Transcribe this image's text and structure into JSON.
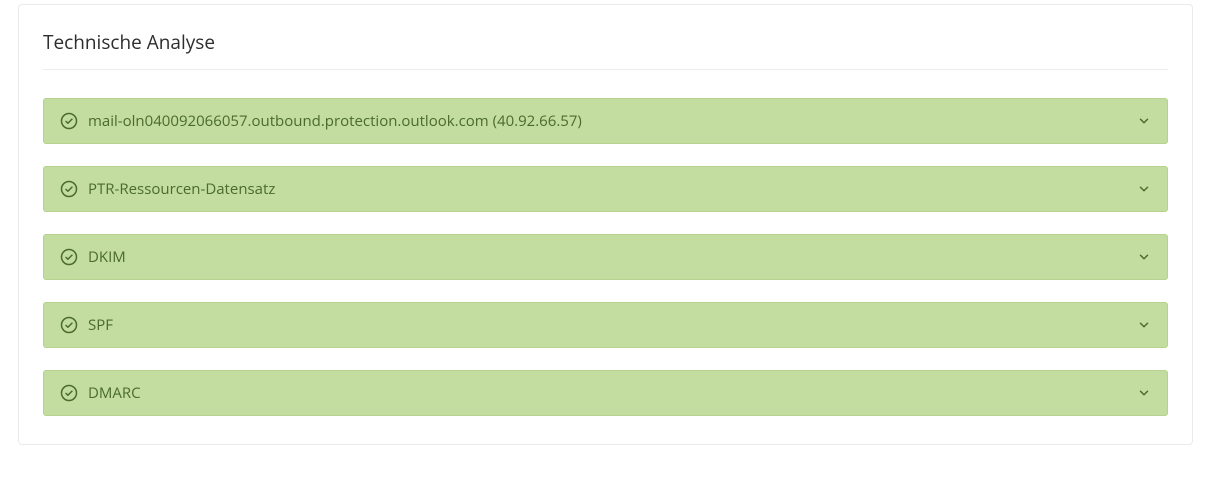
{
  "panel": {
    "title": "Technische Analyse",
    "items": [
      {
        "label": "mail-oln040092066057.outbound.protection.outlook.com (40.92.66.57)"
      },
      {
        "label": "PTR-Ressourcen-Datensatz"
      },
      {
        "label": "DKIM"
      },
      {
        "label": "SPF"
      },
      {
        "label": "DMARC"
      }
    ]
  },
  "colors": {
    "success_bg": "#c3dca0",
    "success_border": "#b6d28e",
    "success_text": "#4a6b2b"
  }
}
